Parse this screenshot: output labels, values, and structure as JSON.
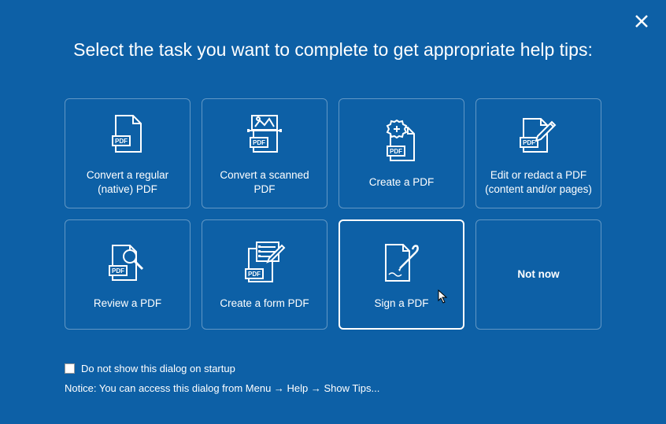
{
  "header": "Select the task you want to complete to get appropriate help tips:",
  "tiles": {
    "convert_native": "Convert a regular (native) PDF",
    "convert_scanned": "Convert a scanned PDF",
    "create": "Create a PDF",
    "edit": "Edit or redact a PDF (content and/or pages)",
    "review": "Review a PDF",
    "form": "Create a form PDF",
    "sign": "Sign a PDF",
    "notnow": "Not now"
  },
  "footer": {
    "checkbox_label": "Do not show this dialog on startup",
    "notice": "Notice: You can access this dialog from Menu → Help → Show Tips..."
  }
}
